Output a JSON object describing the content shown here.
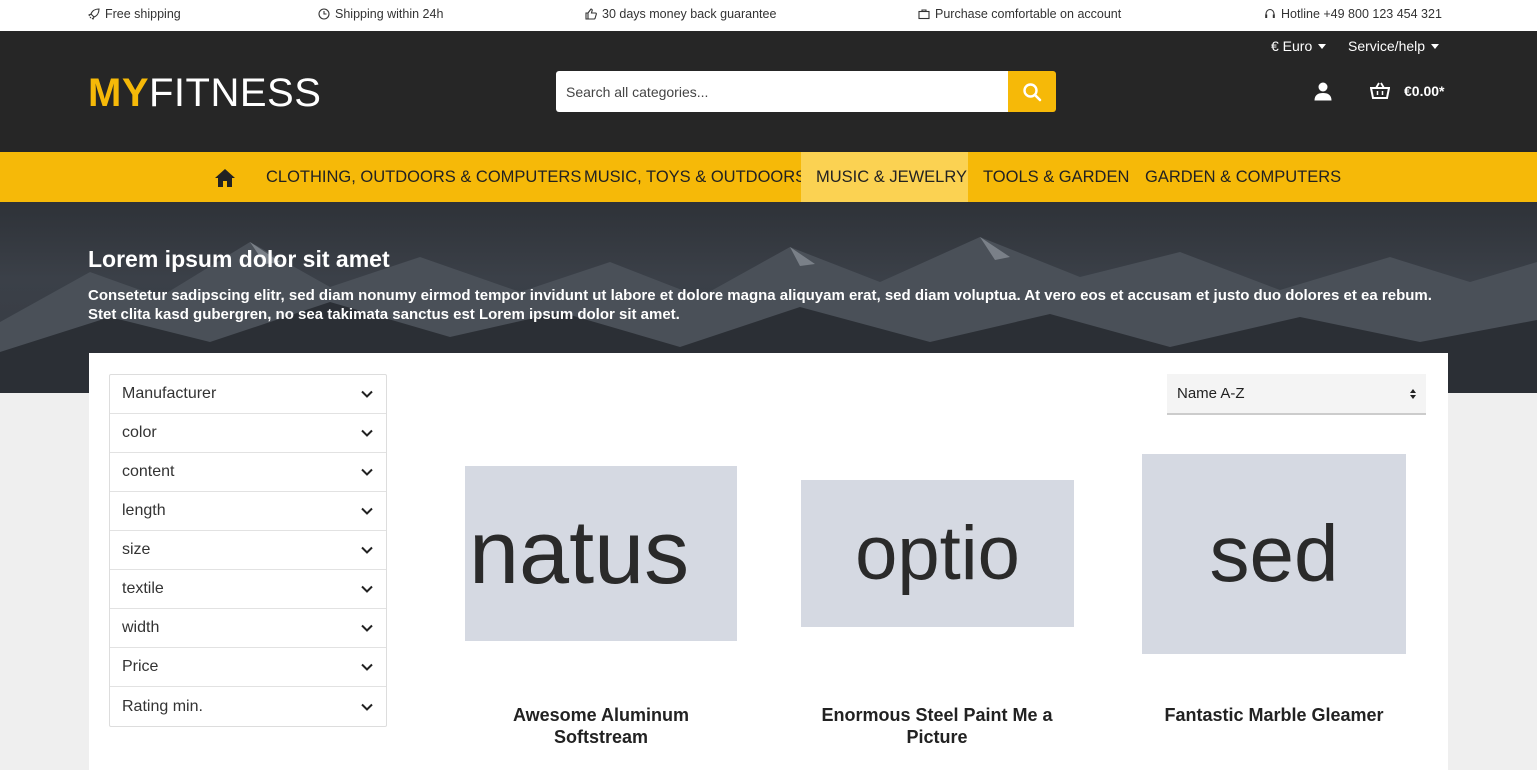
{
  "topbar": {
    "shipping": "Free shipping",
    "delivery": "Shipping within 24h",
    "guarantee": "30 days money back guarantee",
    "account": "Purchase comfortable on account",
    "hotline": "Hotline +49 800 123 454 321"
  },
  "header": {
    "logo_bold": "MY",
    "logo_light": "FITNESS",
    "search_placeholder": "Search all categories...",
    "currency": "€ Euro",
    "service": "Service/help",
    "cart_total": "€0.00*"
  },
  "nav": {
    "items": [
      {
        "label": "Clothing, Outdoors & Computers"
      },
      {
        "label": "Music, Toys & Outdoors"
      },
      {
        "label": "Music & Jewelry"
      },
      {
        "label": "Tools & Garden"
      },
      {
        "label": "Garden & Computers"
      }
    ],
    "active_index": 2
  },
  "hero": {
    "title": "Lorem ipsum dolor sit amet",
    "text": "Consetetur sadipscing elitr, sed diam nonumy eirmod tempor invidunt ut labore et dolore magna aliquyam erat, sed diam voluptua. At vero eos et accusam et justo duo dolores et ea rebum. Stet clita kasd gubergren, no sea takimata sanctus est Lorem ipsum dolor sit amet."
  },
  "filters": [
    {
      "label": "Manufacturer"
    },
    {
      "label": "color"
    },
    {
      "label": "content"
    },
    {
      "label": "length"
    },
    {
      "label": "size"
    },
    {
      "label": "textile"
    },
    {
      "label": "width"
    },
    {
      "label": "Price"
    },
    {
      "label": "Rating min."
    }
  ],
  "sort": {
    "selected": "Name A-Z"
  },
  "products": [
    {
      "image_text": "natus",
      "name": "Awesome Aluminum Softstream"
    },
    {
      "image_text": "optio",
      "name": "Enormous Steel Paint Me a Picture"
    },
    {
      "image_text": "sed",
      "name": "Fantastic Marble Gleamer"
    }
  ],
  "colors": {
    "brand": "#f6b908",
    "header_bg": "#262626",
    "nav_active": "#fbd252"
  }
}
